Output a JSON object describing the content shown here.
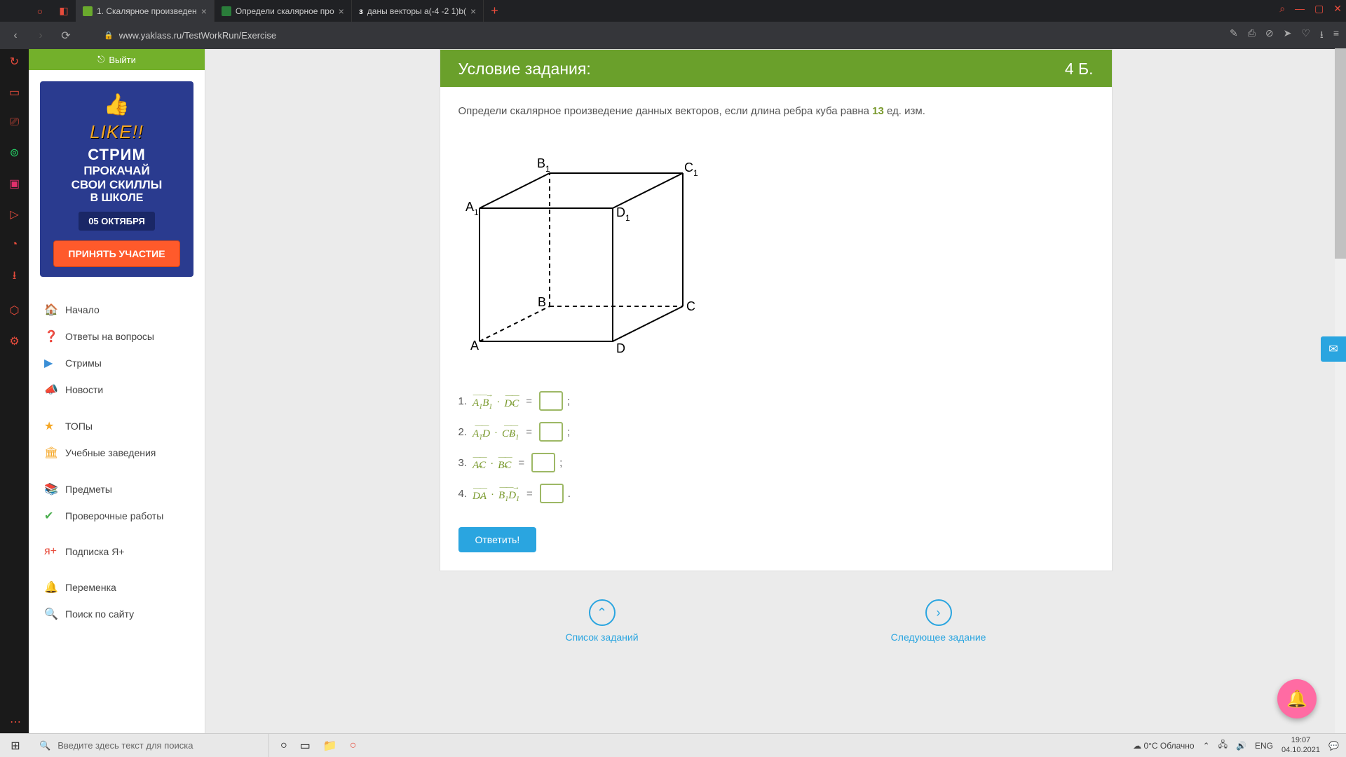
{
  "browser": {
    "tabs": [
      {
        "label": "1. Скалярное произведен",
        "active": true
      },
      {
        "label": "Определи скалярное про",
        "active": false
      },
      {
        "label": "даны векторы a(-4 -2 1)b(",
        "prefix": "з",
        "active": false
      }
    ],
    "url": "www.yaklass.ru/TestWorkRun/Exercise"
  },
  "sidebar": {
    "exit": "Выйти",
    "ad": {
      "like": "LIKE!!",
      "title": "СТРИМ",
      "l2": "ПРОКАЧАЙ",
      "l3": "СВОИ СКИЛЛЫ",
      "l4": "В ШКОЛЕ",
      "date": "05 ОКТЯБРЯ",
      "btn": "ПРИНЯТЬ УЧАСТИЕ"
    },
    "menu": [
      {
        "icon": "🏠",
        "label": "Начало",
        "iclass": "c-blue"
      },
      {
        "icon": "❓",
        "label": "Ответы на вопросы",
        "iclass": "c-blue"
      },
      {
        "icon": "▶",
        "label": "Стримы",
        "iclass": "c-blue"
      },
      {
        "icon": "📣",
        "label": "Новости",
        "iclass": "c-blue"
      },
      {
        "sep": true
      },
      {
        "icon": "★",
        "label": "ТОПы",
        "iclass": "c-orange"
      },
      {
        "icon": "🏛",
        "label": "Учебные заведения",
        "iclass": "c-orange"
      },
      {
        "sep": true
      },
      {
        "icon": "📚",
        "label": "Предметы",
        "iclass": "c-green"
      },
      {
        "icon": "✔",
        "label": "Проверочные работы",
        "iclass": "c-green"
      },
      {
        "sep": true
      },
      {
        "icon": "я+",
        "label": "Подписка Я+",
        "iclass": "c-red"
      },
      {
        "sep": true
      },
      {
        "icon": "🔔",
        "label": "Переменка",
        "iclass": "c-dark"
      },
      {
        "icon": "🔍",
        "label": "Поиск по сайту",
        "iclass": "c-dark"
      }
    ]
  },
  "task": {
    "header": "Условие задания:",
    "points": "4 Б.",
    "text_before": "Определи скалярное произведение данных векторов, если длина ребра куба равна ",
    "edge": "13",
    "text_after": " ед. изм.",
    "cube_labels": {
      "A": "A",
      "B": "B",
      "C": "C",
      "D": "D",
      "A1": "A",
      "B1": "B",
      "C1": "C",
      "D1": "D",
      "sub": "1"
    },
    "questions": [
      {
        "n": "1.",
        "v1": "A₁B₁",
        "v2": "DC",
        "tail": ";"
      },
      {
        "n": "2.",
        "v1": "A₁D",
        "v2": "CB₁",
        "tail": ";"
      },
      {
        "n": "3.",
        "v1": "AC",
        "v2": "BC",
        "tail": ";"
      },
      {
        "n": "4.",
        "v1": "DA",
        "v2": "B₁D₁",
        "tail": "."
      }
    ],
    "answer_btn": "Ответить!"
  },
  "bottomnav": {
    "list": "Список заданий",
    "next": "Следующее задание"
  },
  "taskbar": {
    "search_ph": "Введите здесь текст для поиска",
    "weather": "0°C  Облачно",
    "lang": "ENG",
    "time": "19:07",
    "date": "04.10.2021"
  }
}
